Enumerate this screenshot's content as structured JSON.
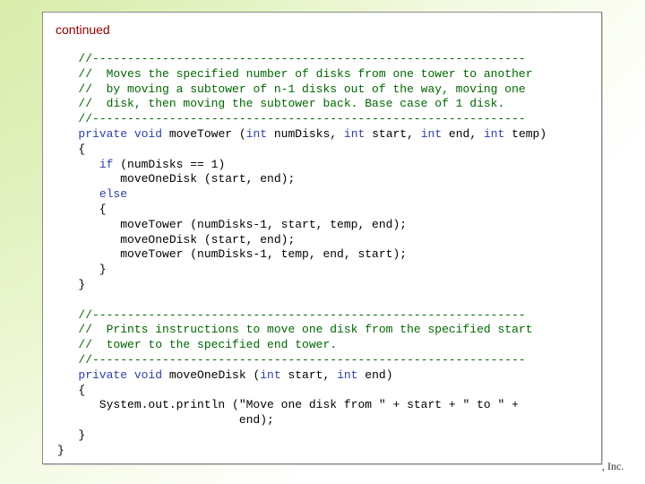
{
  "slide": {
    "continued_label": "continued",
    "copyright_fragment": ", Inc."
  },
  "code_lines": [
    [
      {
        "t": "   ",
        "c": "plain"
      },
      {
        "t": "//--------------------------------------------------------------",
        "c": "comment"
      }
    ],
    [
      {
        "t": "   ",
        "c": "plain"
      },
      {
        "t": "//  Moves the specified number of disks from one tower to another",
        "c": "comment"
      }
    ],
    [
      {
        "t": "   ",
        "c": "plain"
      },
      {
        "t": "//  by moving a subtower of n-1 disks out of the way, moving one",
        "c": "comment"
      }
    ],
    [
      {
        "t": "   ",
        "c": "plain"
      },
      {
        "t": "//  disk, then moving the subtower back. Base case of 1 disk.",
        "c": "comment"
      }
    ],
    [
      {
        "t": "   ",
        "c": "plain"
      },
      {
        "t": "//--------------------------------------------------------------",
        "c": "comment"
      }
    ],
    [
      {
        "t": "   ",
        "c": "plain"
      },
      {
        "t": "private void",
        "c": "keyword"
      },
      {
        "t": " moveTower (",
        "c": "plain"
      },
      {
        "t": "int",
        "c": "keyword"
      },
      {
        "t": " numDisks, ",
        "c": "plain"
      },
      {
        "t": "int",
        "c": "keyword"
      },
      {
        "t": " start, ",
        "c": "plain"
      },
      {
        "t": "int",
        "c": "keyword"
      },
      {
        "t": " end, ",
        "c": "plain"
      },
      {
        "t": "int",
        "c": "keyword"
      },
      {
        "t": " temp)",
        "c": "plain"
      }
    ],
    [
      {
        "t": "   {",
        "c": "plain"
      }
    ],
    [
      {
        "t": "      ",
        "c": "plain"
      },
      {
        "t": "if",
        "c": "keyword"
      },
      {
        "t": " (numDisks == 1)",
        "c": "plain"
      }
    ],
    [
      {
        "t": "         moveOneDisk (start, end);",
        "c": "plain"
      }
    ],
    [
      {
        "t": "      ",
        "c": "plain"
      },
      {
        "t": "else",
        "c": "keyword"
      }
    ],
    [
      {
        "t": "      {",
        "c": "plain"
      }
    ],
    [
      {
        "t": "         moveTower (numDisks-1, start, temp, end);",
        "c": "plain"
      }
    ],
    [
      {
        "t": "         moveOneDisk (start, end);",
        "c": "plain"
      }
    ],
    [
      {
        "t": "         moveTower (numDisks-1, temp, end, start);",
        "c": "plain"
      }
    ],
    [
      {
        "t": "      }",
        "c": "plain"
      }
    ],
    [
      {
        "t": "   }",
        "c": "plain"
      }
    ],
    [
      {
        "t": "",
        "c": "plain"
      }
    ],
    [
      {
        "t": "   ",
        "c": "plain"
      },
      {
        "t": "//--------------------------------------------------------------",
        "c": "comment"
      }
    ],
    [
      {
        "t": "   ",
        "c": "plain"
      },
      {
        "t": "//  Prints instructions to move one disk from the specified start",
        "c": "comment"
      }
    ],
    [
      {
        "t": "   ",
        "c": "plain"
      },
      {
        "t": "//  tower to the specified end tower.",
        "c": "comment"
      }
    ],
    [
      {
        "t": "   ",
        "c": "plain"
      },
      {
        "t": "//--------------------------------------------------------------",
        "c": "comment"
      }
    ],
    [
      {
        "t": "   ",
        "c": "plain"
      },
      {
        "t": "private void",
        "c": "keyword"
      },
      {
        "t": " moveOneDisk (",
        "c": "plain"
      },
      {
        "t": "int",
        "c": "keyword"
      },
      {
        "t": " start, ",
        "c": "plain"
      },
      {
        "t": "int",
        "c": "keyword"
      },
      {
        "t": " end)",
        "c": "plain"
      }
    ],
    [
      {
        "t": "   {",
        "c": "plain"
      }
    ],
    [
      {
        "t": "      System.out.println (\"Move one disk from \" + start + \" to \" +",
        "c": "plain"
      }
    ],
    [
      {
        "t": "                          end);",
        "c": "plain"
      }
    ],
    [
      {
        "t": "   }",
        "c": "plain"
      }
    ],
    [
      {
        "t": "}",
        "c": "plain"
      }
    ]
  ],
  "colors": {
    "comment": "#006600",
    "keyword": "#2e3fa3",
    "continued_label": "#8b0000"
  }
}
